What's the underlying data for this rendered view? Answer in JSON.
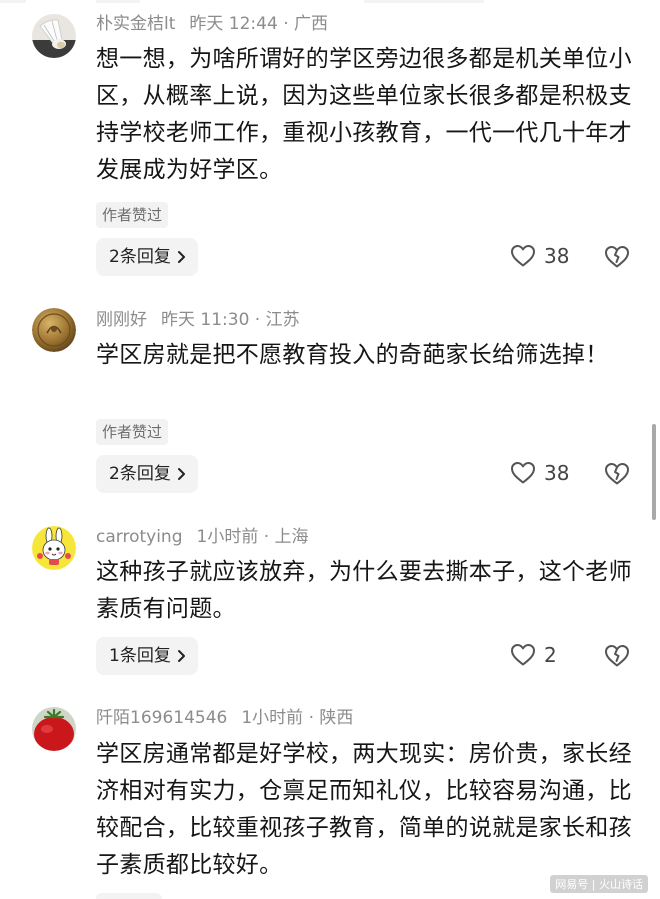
{
  "comments": [
    {
      "username": "朴实金桔lt",
      "time": "昨天 12:44",
      "location": "广西",
      "text": "想一想，为啥所谓好的学区旁边很多都是机关单位小区，从概率上说，因为这些单位家长很多都是积极支持学校老师工作，重视小孩教育，一代一代几十年才发展成为好学区。",
      "badge": "作者赞过",
      "reply_label": "2条回复",
      "likes": "38",
      "avatar_icon": "badminton-shuttlecock-avatar"
    },
    {
      "username": "刚刚好",
      "time": "昨天 11:30",
      "location": "江苏",
      "text": "学区房就是把不愿教育投入的奇葩家长给筛选掉！",
      "badge": "作者赞过",
      "reply_label": "2条回复",
      "likes": "38",
      "avatar_icon": "gold-coin-avatar"
    },
    {
      "username": "carrotying",
      "time": "1小时前",
      "location": "上海",
      "text": "这种孩子就应该放弃，为什么要去撕本子，这个老师素质有问题。",
      "reply_label": "1条回复",
      "likes": "2",
      "avatar_icon": "cartoon-rabbit-avatar"
    },
    {
      "username": "阡陌169614546",
      "time": "1小时前",
      "location": "陕西",
      "text": "学区房通常都是好学校，两大现实：房价贵，家长经济相对有实力，仓禀足而知礼仪，比较容易沟通，比较配合，比较重视孩子教育，简单的说就是家长和孩子素质都比较好。",
      "avatar_icon": "red-tomato-avatar"
    }
  ],
  "separator": " · ",
  "icons": {
    "like": "heart-outline-icon",
    "dislike": "broken-heart-icon",
    "chevron": "chevron-right-icon"
  },
  "watermark": "网易号 | 火山诗话",
  "colors": {
    "meta_gray": "#8c8c8c",
    "body_text": "#161616",
    "pill_bg": "#f3f3f3"
  }
}
